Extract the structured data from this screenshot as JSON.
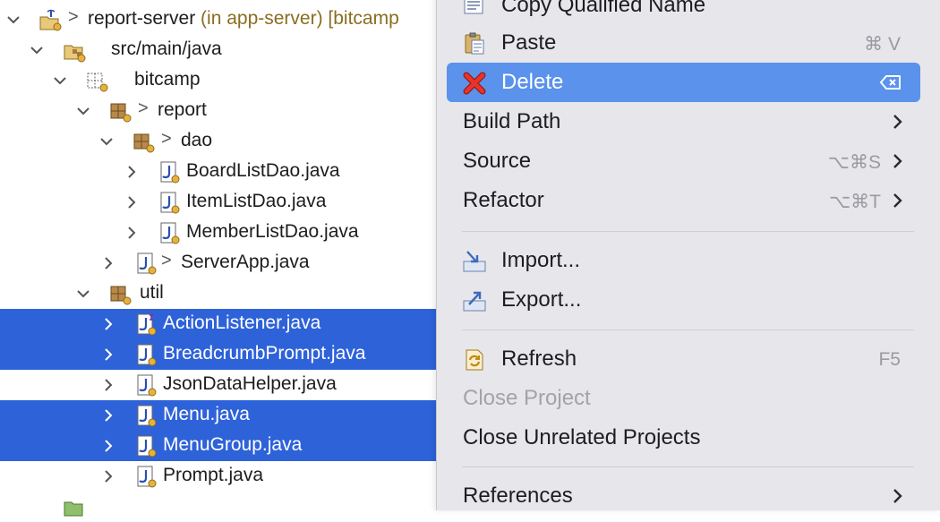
{
  "tree": {
    "rows": [
      {
        "label": "report-server",
        "sub": " (in app-server) [bitcamp",
        "prefix": ">"
      },
      {
        "label": "src/main/java"
      },
      {
        "label": "bitcamp"
      },
      {
        "label": "report",
        "prefix": ">"
      },
      {
        "label": "dao",
        "prefix": ">"
      },
      {
        "label": "BoardListDao.java"
      },
      {
        "label": "ItemListDao.java"
      },
      {
        "label": "MemberListDao.java"
      },
      {
        "label": "ServerApp.java",
        "prefix": ">"
      },
      {
        "label": "util"
      },
      {
        "label": "ActionListener.java"
      },
      {
        "label": "BreadcrumbPrompt.java"
      },
      {
        "label": "JsonDataHelper.java"
      },
      {
        "label": "Menu.java"
      },
      {
        "label": "MenuGroup.java"
      },
      {
        "label": "Prompt.java"
      }
    ]
  },
  "menu": {
    "items": [
      {
        "label": "Copy Qualified Name",
        "icon": "copy-name-icon"
      },
      {
        "label": "Paste",
        "icon": "paste-icon",
        "shortcut": "⌘ V"
      },
      {
        "label": "Delete",
        "icon": "delete-icon",
        "active": true
      },
      {
        "label": "Build Path",
        "submenu": true
      },
      {
        "label": "Source",
        "shortcut": "⌥⌘S",
        "submenu": true
      },
      {
        "label": "Refactor",
        "shortcut": "⌥⌘T",
        "submenu": true
      },
      {
        "label": "Import...",
        "icon": "import-icon"
      },
      {
        "label": "Export...",
        "icon": "export-icon"
      },
      {
        "label": "Refresh",
        "icon": "refresh-icon",
        "shortcut": "F5"
      },
      {
        "label": "Close Project",
        "disabled": true
      },
      {
        "label": "Close Unrelated Projects"
      },
      {
        "label": "References",
        "submenu": true
      }
    ]
  },
  "colors": {
    "selection": "#2e62d9",
    "menu_active": "#5a92ec",
    "menu_bg": "#e7e6ea"
  }
}
